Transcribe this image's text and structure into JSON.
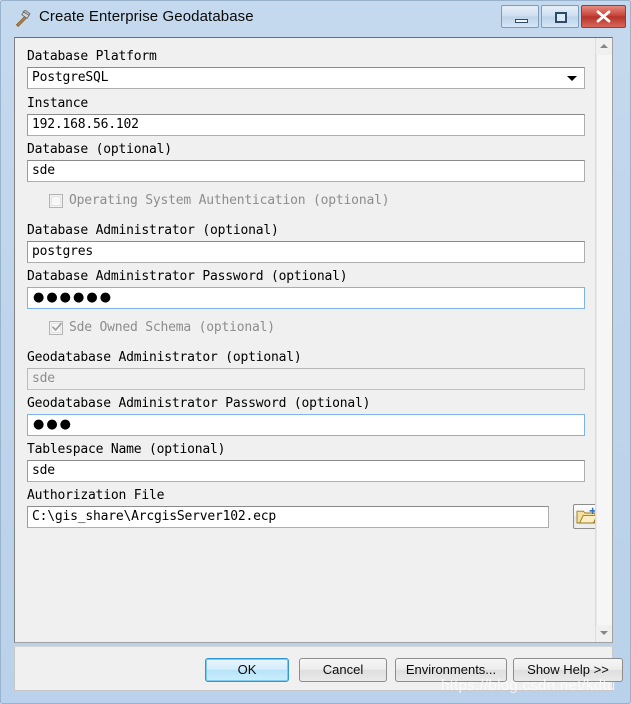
{
  "window": {
    "title": "Create Enterprise Geodatabase",
    "icon": "hammer-tool-icon",
    "controls": {
      "minimize": "Minimize",
      "maximize": "Maximize",
      "close": "Close"
    }
  },
  "fields": [
    {
      "label": "Database Platform",
      "value": "PostgreSQL",
      "type": "combobox",
      "disabled": false,
      "focused": false
    },
    {
      "label": "Instance",
      "value": "192.168.56.102",
      "type": "text",
      "disabled": false,
      "focused": false
    },
    {
      "label": "Database  (optional)",
      "value": "sde",
      "type": "text",
      "disabled": false,
      "focused": false
    },
    {
      "label": "Operating System Authentication  (optional)",
      "value": "",
      "type": "checkbox",
      "checked": false,
      "disabled": true,
      "focused": false
    },
    {
      "label": "Database Administrator  (optional)",
      "value": "postgres",
      "type": "text",
      "disabled": false,
      "focused": false
    },
    {
      "label": "Database Administrator Password  (optional)",
      "value": "●●●●●●",
      "type": "password",
      "disabled": false,
      "focused": true
    },
    {
      "label": "Sde Owned Schema  (optional)",
      "value": "",
      "type": "checkbox",
      "checked": true,
      "disabled": true,
      "focused": false
    },
    {
      "label": "Geodatabase Administrator  (optional)",
      "value": "sde",
      "type": "text",
      "disabled": true,
      "focused": false
    },
    {
      "label": "Geodatabase Administrator Password  (optional)",
      "value": "●●●",
      "type": "password",
      "disabled": false,
      "focused": true
    },
    {
      "label": "Tablespace Name  (optional)",
      "value": "sde",
      "type": "text",
      "disabled": false,
      "focused": false
    },
    {
      "label": "Authorization File",
      "value": "C:\\gis_share\\ArcgisServer102.ecp",
      "type": "file",
      "disabled": false,
      "focused": false,
      "browse_icon": "open-folder-icon"
    }
  ],
  "buttons": {
    "ok": "OK",
    "cancel": "Cancel",
    "environments": "Environments...",
    "show_help": "Show Help >>"
  },
  "scrollbar": {
    "up_arrow": "scroll-up-arrow",
    "down_arrow": "scroll-down-arrow"
  },
  "watermark": "https://blog.csdn.net/kdtu",
  "colors": {
    "window_frame": "#b9d1ea",
    "content_bg": "#f0f0f0",
    "input_bg": "#ffffff",
    "focus_border": "#7eb4ea",
    "default_button_border": "#2f97d4",
    "disabled_text": "#8d8d8d",
    "close_button": "#c9453a"
  }
}
